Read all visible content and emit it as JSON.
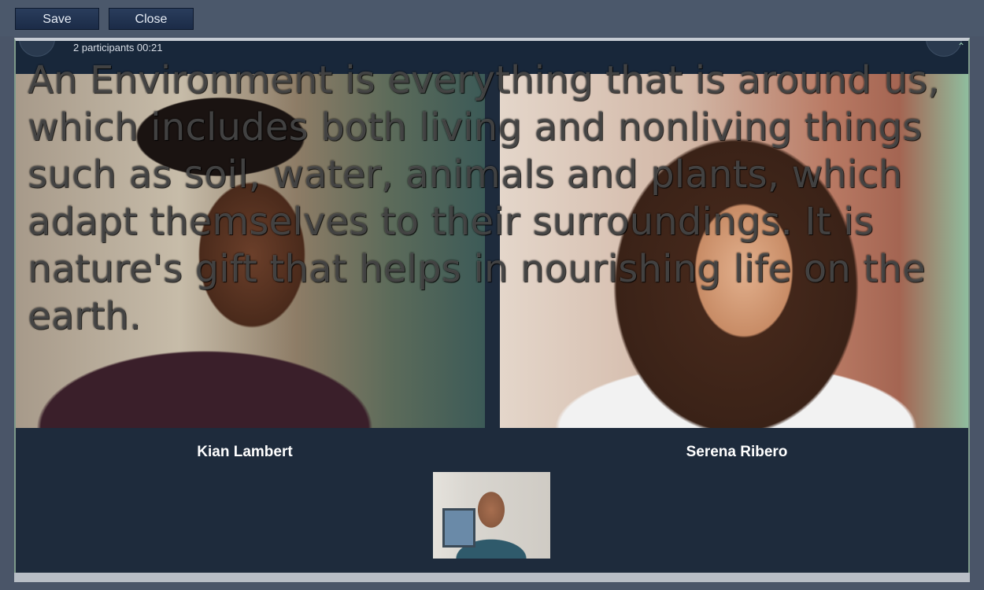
{
  "toolbar": {
    "save_label": "Save",
    "close_label": "Close"
  },
  "call": {
    "participants_status": "2 participants  00:21",
    "tiles": [
      {
        "name": "Kian Lambert"
      },
      {
        "name": "Serena Ribero"
      }
    ]
  },
  "overlay": {
    "text": "An Environment is everything that is around us, which includes both living and nonliving things such as soil, water, animals and plants, which adapt themselves to their surroundings. It is nature's gift that helps in nourishing life on the earth."
  },
  "colors": {
    "background": "#4a5568",
    "window": "#1e2b3c",
    "button": "#1b2b47"
  },
  "icons": {
    "scroll_up": "chevron-up-icon",
    "scroll_down": "chevron-down-icon"
  }
}
